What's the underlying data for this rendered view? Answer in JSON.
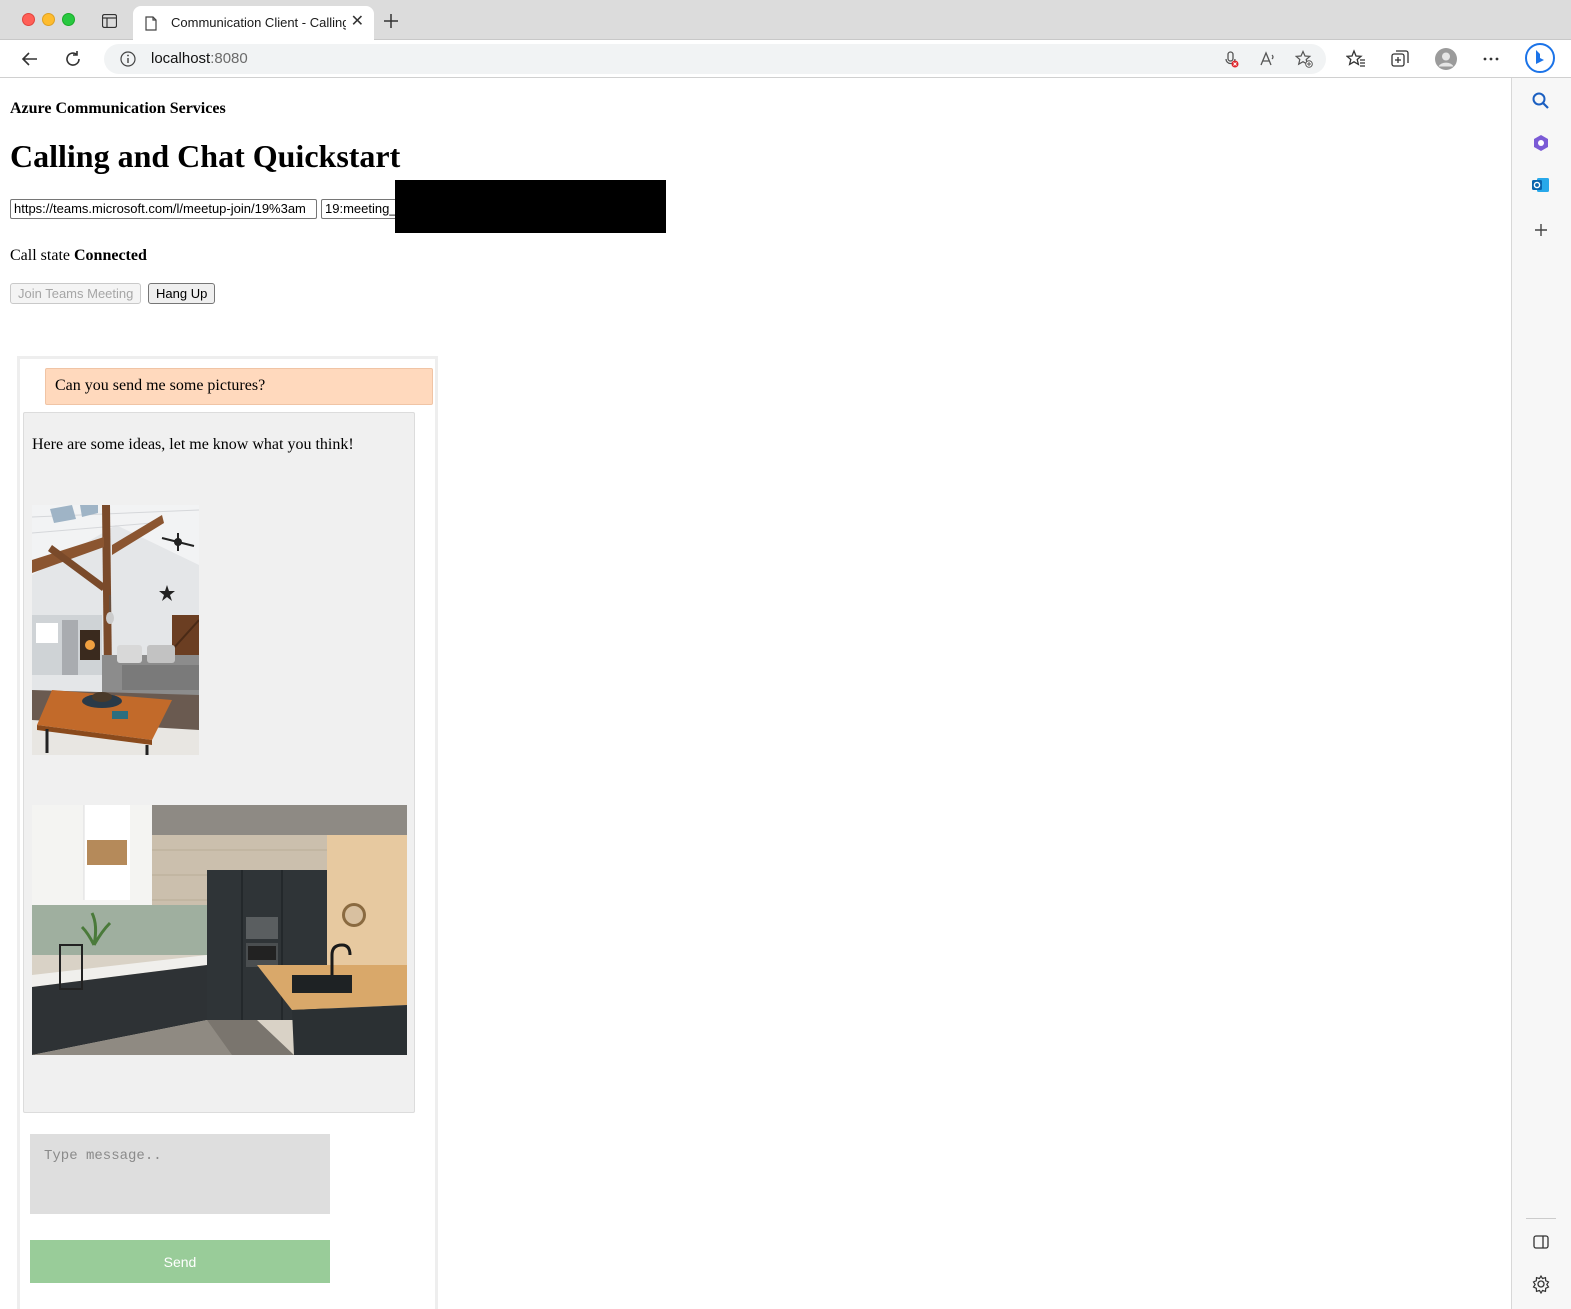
{
  "browser": {
    "tab_title": "Communication Client - Calling",
    "url_host": "localhost",
    "url_port": ":8080"
  },
  "page": {
    "service_title": "Azure Communication Services",
    "title": "Calling and Chat Quickstart",
    "meeting_link_value": "https://teams.microsoft.com/l/meetup-join/19%3am",
    "thread_id_value": "19:meeting_",
    "call_state_label": "Call state",
    "call_state_value": "Connected",
    "join_button": "Join Teams Meeting",
    "hangup_button": "Hang Up"
  },
  "chat": {
    "messages": [
      {
        "direction": "sent",
        "text": "Can you send me some pictures?"
      },
      {
        "direction": "received",
        "text": "Here are some ideas, let me know what you think!",
        "images": [
          "living-room-photo",
          "kitchen-photo"
        ]
      }
    ],
    "input_placeholder": "Type message..",
    "send_button": "Send"
  }
}
